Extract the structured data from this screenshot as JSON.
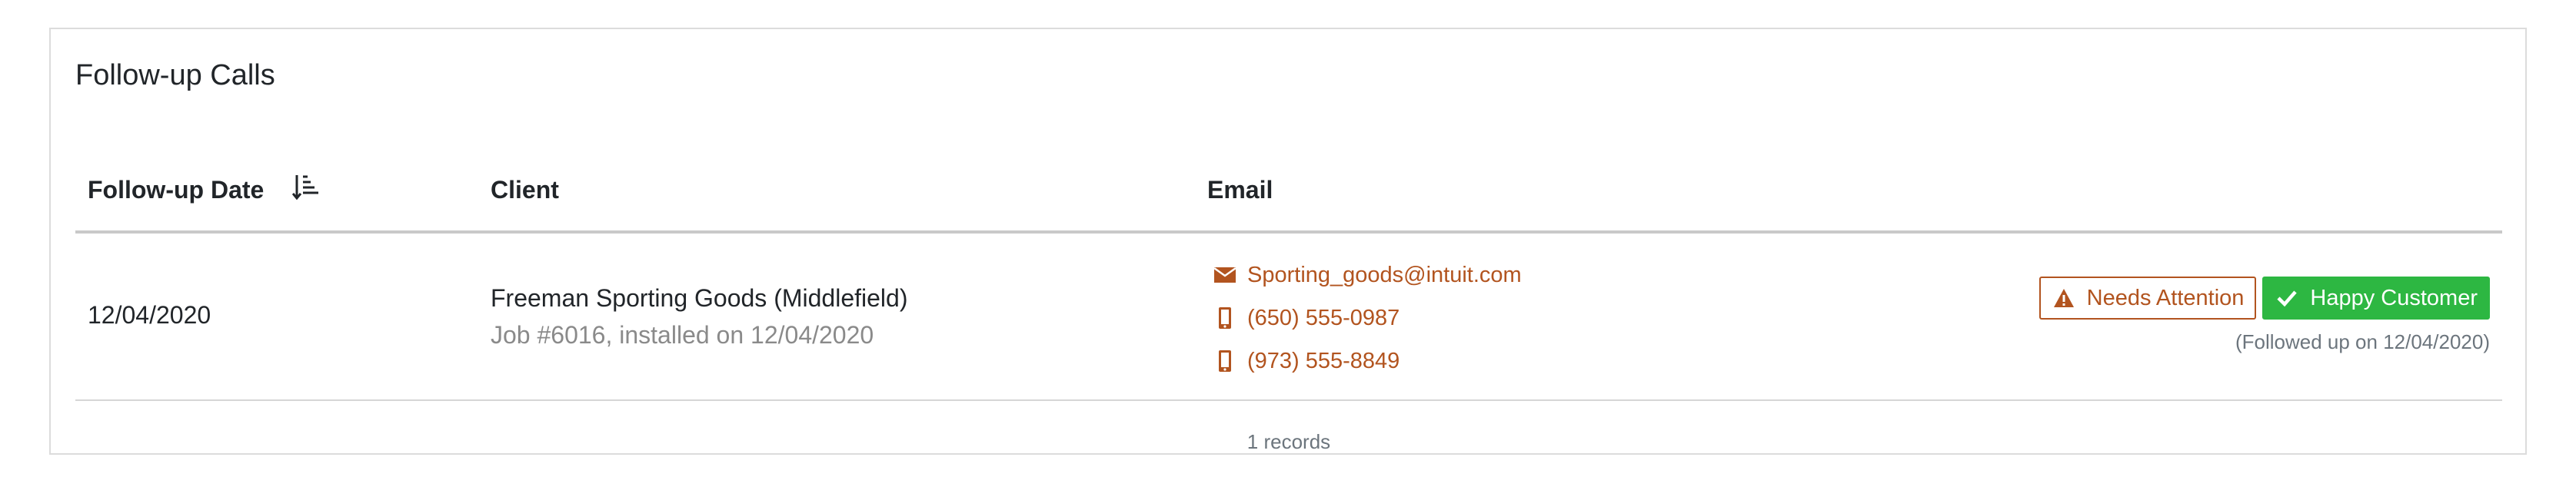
{
  "card": {
    "title": "Follow-up Calls"
  },
  "table": {
    "headers": {
      "date": "Follow-up Date",
      "client": "Client",
      "email": "Email"
    },
    "sort_icon": "sort-descending-icon",
    "rows": [
      {
        "date": "12/04/2020",
        "client_name": "Freeman Sporting Goods (Middlefield)",
        "client_sub": "Job #6016, installed on 12/04/2020",
        "email": "Sporting_goods@intuit.com",
        "phone_1": "(650) 555-0987",
        "phone_2": "(973) 555-8849",
        "btn_attention": "Needs Attention",
        "btn_happy": "Happy Customer",
        "followed_note": "(Followed up on 12/04/2020)"
      }
    ],
    "records_text": "1 records"
  },
  "colors": {
    "link": "#b2541f",
    "success": "#2db742",
    "muted": "#8a8a8a",
    "border": "#c9c9c9"
  }
}
